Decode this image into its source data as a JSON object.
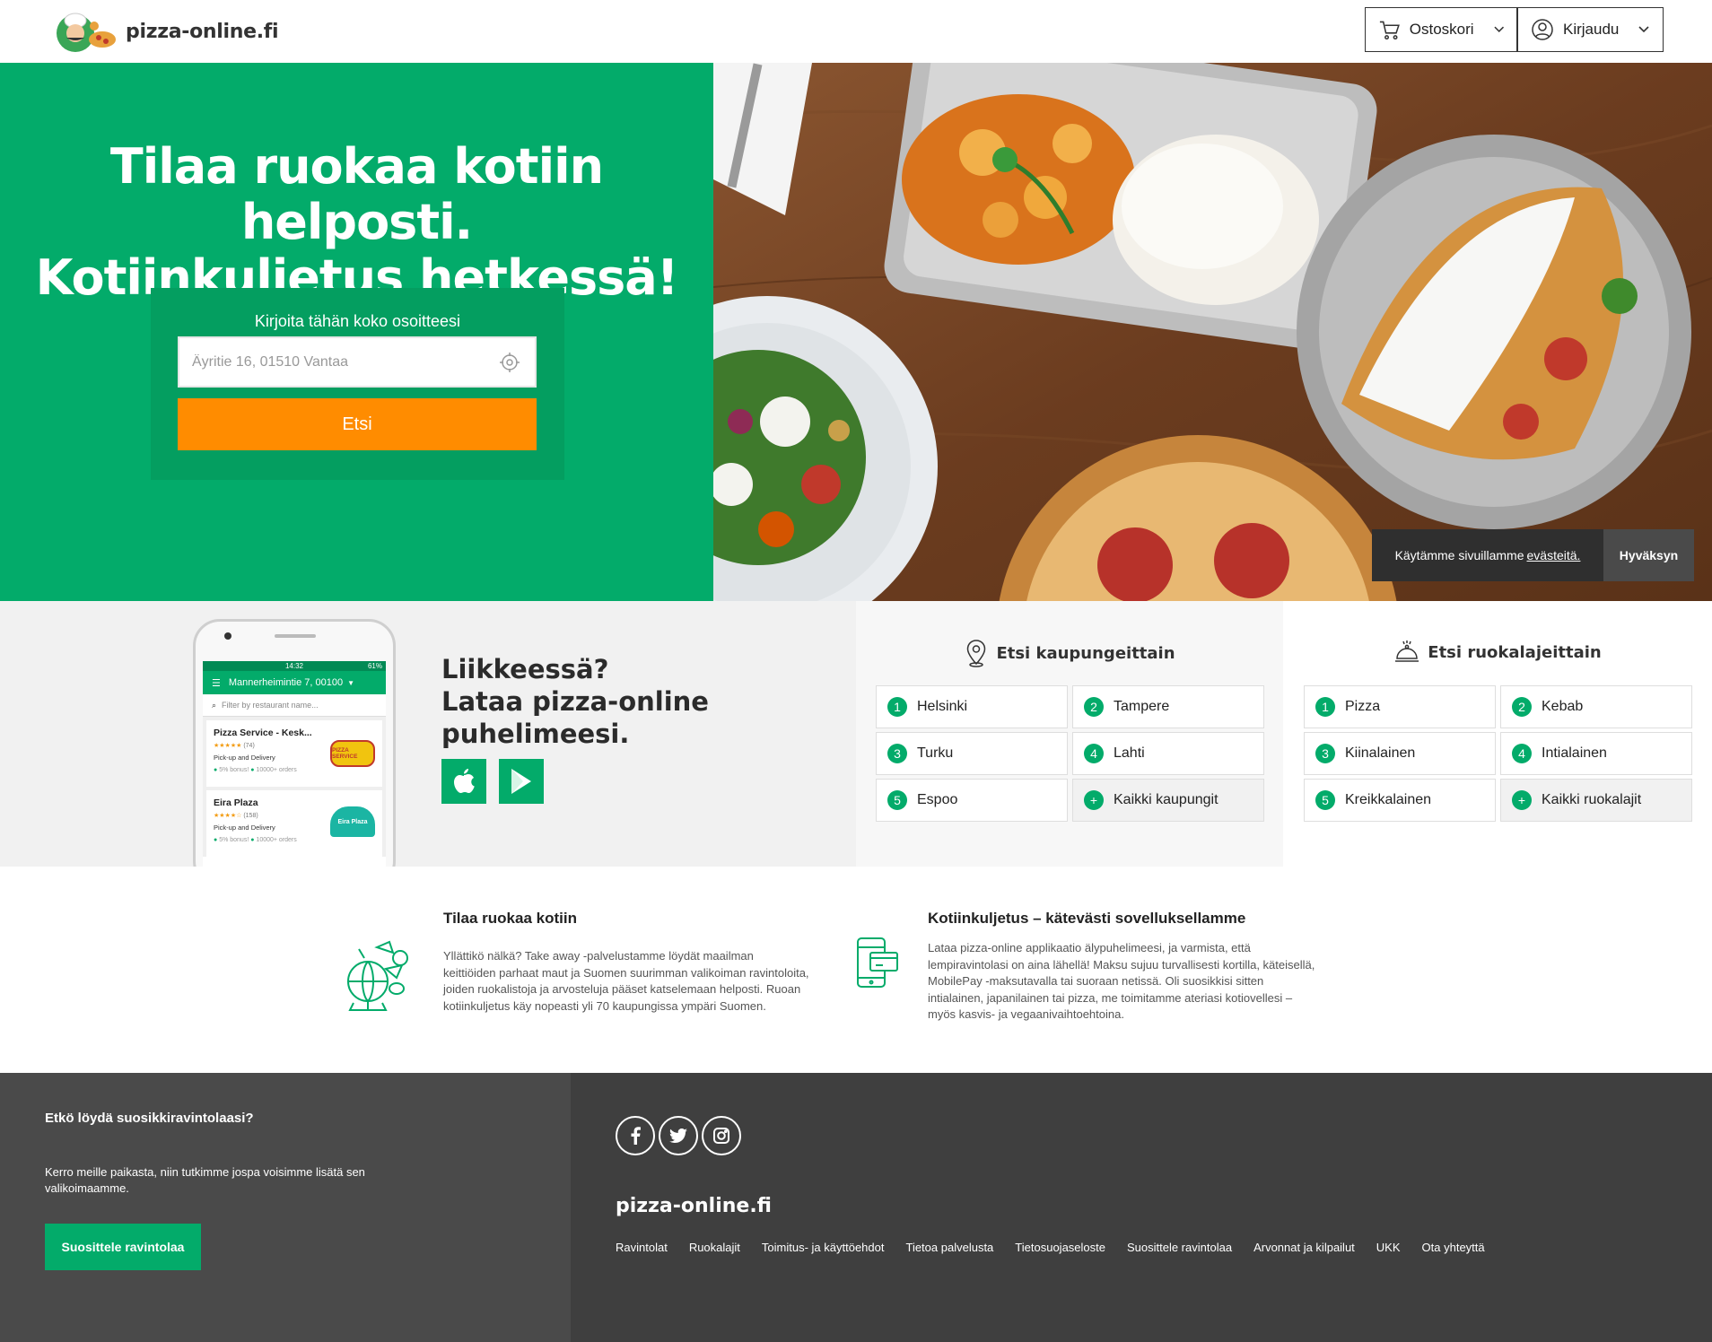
{
  "header": {
    "logo_text": "pizza-online.fi",
    "cart_label": "Ostoskori",
    "login_label": "Kirjaudu"
  },
  "hero": {
    "title_line1": "Tilaa ruokaa kotiin helposti.",
    "title_line2": "Kotiinkuljetus hetkessä!",
    "search_label": "Kirjoita tähän koko osoitteesi",
    "address_placeholder": "Äyritie 16, 01510 Vantaa",
    "search_button": "Etsi"
  },
  "cookie": {
    "text": "Käytämme sivuillamme",
    "link": "evästeitä.",
    "accept": "Hyväksyn"
  },
  "app_promo": {
    "line1": "Liikkeessä?",
    "line2": "Lataa pizza-online",
    "line3": "puhelimeesi.",
    "phone": {
      "time": "14:32",
      "battery": "61%",
      "address": "Mannerheimintie 7, 00100",
      "filter_placeholder": "Filter by restaurant name...",
      "restaurants": [
        {
          "name": "Pizza Service - Kesk...",
          "reviews": "(74)",
          "mode": "Pick-up and Delivery",
          "bonus": "5% bonus!",
          "orders": "10000+ orders",
          "logo_text": "PIZZA SERVICE"
        },
        {
          "name": "Eira Plaza",
          "reviews": "(158)",
          "mode": "Pick-up and Delivery",
          "bonus": "5% bonus!",
          "orders": "10000+ orders",
          "logo_text": "Eira Plaza"
        }
      ]
    }
  },
  "cities": {
    "title": "Etsi kaupungeittain",
    "items": [
      {
        "num": "1",
        "label": "Helsinki"
      },
      {
        "num": "2",
        "label": "Tampere"
      },
      {
        "num": "3",
        "label": "Turku"
      },
      {
        "num": "4",
        "label": "Lahti"
      },
      {
        "num": "5",
        "label": "Espoo"
      },
      {
        "num": "+",
        "label": "Kaikki kaupungit"
      }
    ]
  },
  "cuisines": {
    "title": "Etsi ruokalajeittain",
    "items": [
      {
        "num": "1",
        "label": "Pizza"
      },
      {
        "num": "2",
        "label": "Kebab"
      },
      {
        "num": "3",
        "label": "Kiinalainen"
      },
      {
        "num": "4",
        "label": "Intialainen"
      },
      {
        "num": "5",
        "label": "Kreikkalainen"
      },
      {
        "num": "+",
        "label": "Kaikki ruokalajit"
      }
    ]
  },
  "info": {
    "col1_title": "Tilaa ruokaa kotiin",
    "col1_lines": [
      "Yllättikö nälkä? Take away -palvelustamme löydät maailman",
      "keittiöiden parhaat maut ja Suomen suurimman valikoiman ravintoloita,",
      "joiden ruokalistoja ja arvosteluja pääset katselemaan helposti. Ruoan",
      "kotiinkuljetus käy nopeasti yli 70 kaupungissa ympäri Suomen."
    ],
    "col2_title": "Kotiinkuljetus – kätevästi sovelluksellamme",
    "col2_lines": [
      "Lataa pizza-online applikaatio älypuhelimeesi, ja varmista, että",
      "lempiravintolasi on aina lähellä! Maksu sujuu turvallisesti kortilla, käteisellä,",
      "MobilePay -maksutavalla tai suoraan netissä. Oli suosikkisi sitten",
      "intialainen, japanilainen tai pizza, me toimitamme ateriasi kotiovellesi –",
      "myös kasvis- ja vegaanivaihtoehtoina."
    ]
  },
  "footer": {
    "suggest_title": "Etkö löydä suosikkiravintolaasi?",
    "suggest_text": "Kerro meille paikasta, niin tutkimme jospa voisimme lisätä sen valikoimaamme.",
    "suggest_button": "Suosittele ravintolaa",
    "logo_text": "pizza-online.fi",
    "links": [
      "Ravintolat",
      "Ruokalajit",
      "Toimitus- ja käyttöehdot",
      "Tietoa palvelusta",
      "Tietosuojaseloste",
      "Suosittele ravintolaa",
      "Arvonnat ja kilpailut",
      "UKK",
      "Ota yhteyttä"
    ]
  },
  "colors": {
    "brand_green": "#03ab6a",
    "search_orange": "#ff8c00",
    "footer_dark": "#3f3f3f"
  }
}
